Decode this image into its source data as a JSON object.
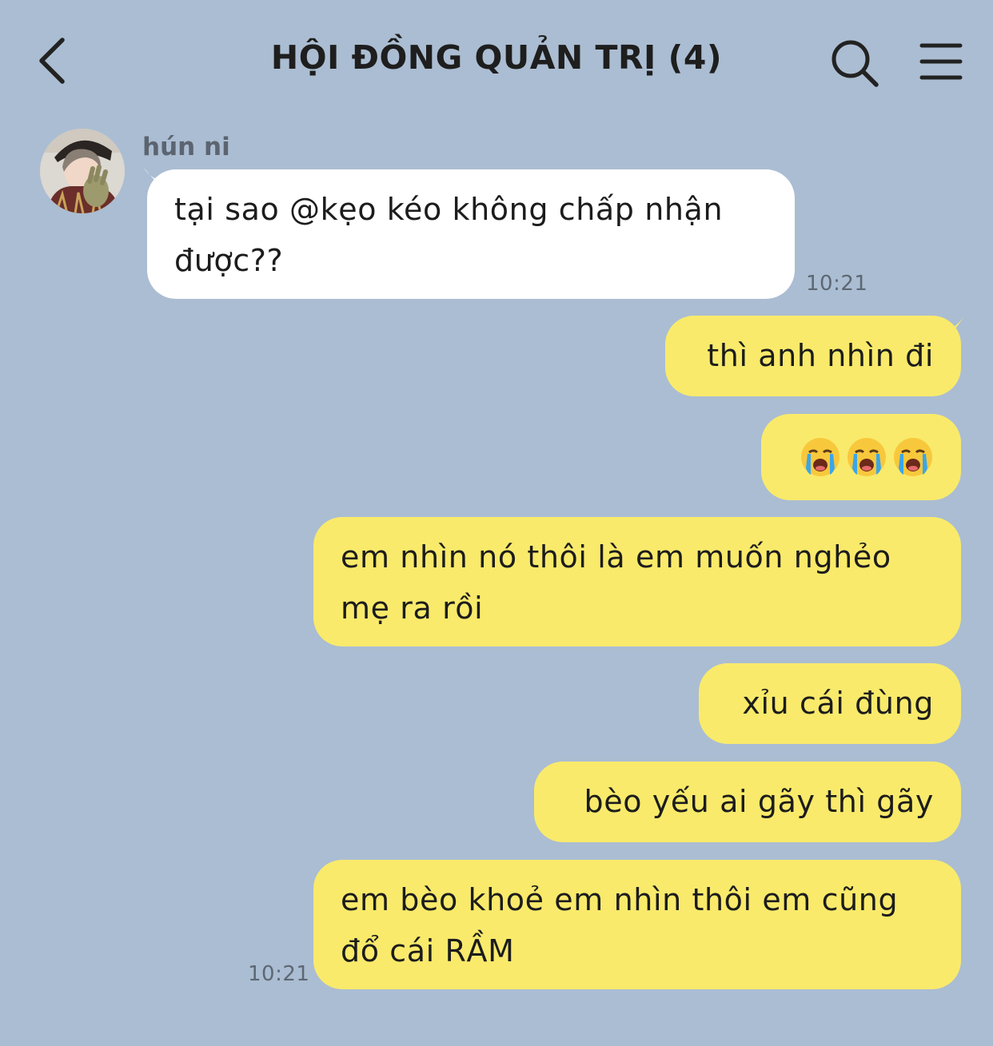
{
  "header": {
    "title": "HỘI ĐỒNG QUẢN TRỊ (4)",
    "back_icon": "chevron-left-icon",
    "search_icon": "search-icon",
    "menu_icon": "hamburger-menu-icon"
  },
  "colors": {
    "background": "#abbdd2",
    "incoming_bubble": "#ffffff",
    "outgoing_bubble": "#f9ea6b"
  },
  "messages": [
    {
      "sender": "hún ni",
      "direction": "incoming",
      "text": "tại sao @kẹo kéo không chấp nhận\nđược??",
      "time": "10:21"
    },
    {
      "direction": "outgoing",
      "text": "thì anh nhìn đi"
    },
    {
      "direction": "outgoing",
      "emoji": "loudly-crying-face",
      "count": 3
    },
    {
      "direction": "outgoing",
      "text": "em nhìn nó thôi là em muốn nghẻo\nmẹ ra rồi"
    },
    {
      "direction": "outgoing",
      "text": "xỉu cái đùng"
    },
    {
      "direction": "outgoing",
      "text": "bèo yếu ai gãy thì gãy"
    },
    {
      "direction": "outgoing",
      "text": "em bèo khoẻ em nhìn thôi em cũng\nđổ cái RẦM",
      "time": "10:21"
    }
  ]
}
